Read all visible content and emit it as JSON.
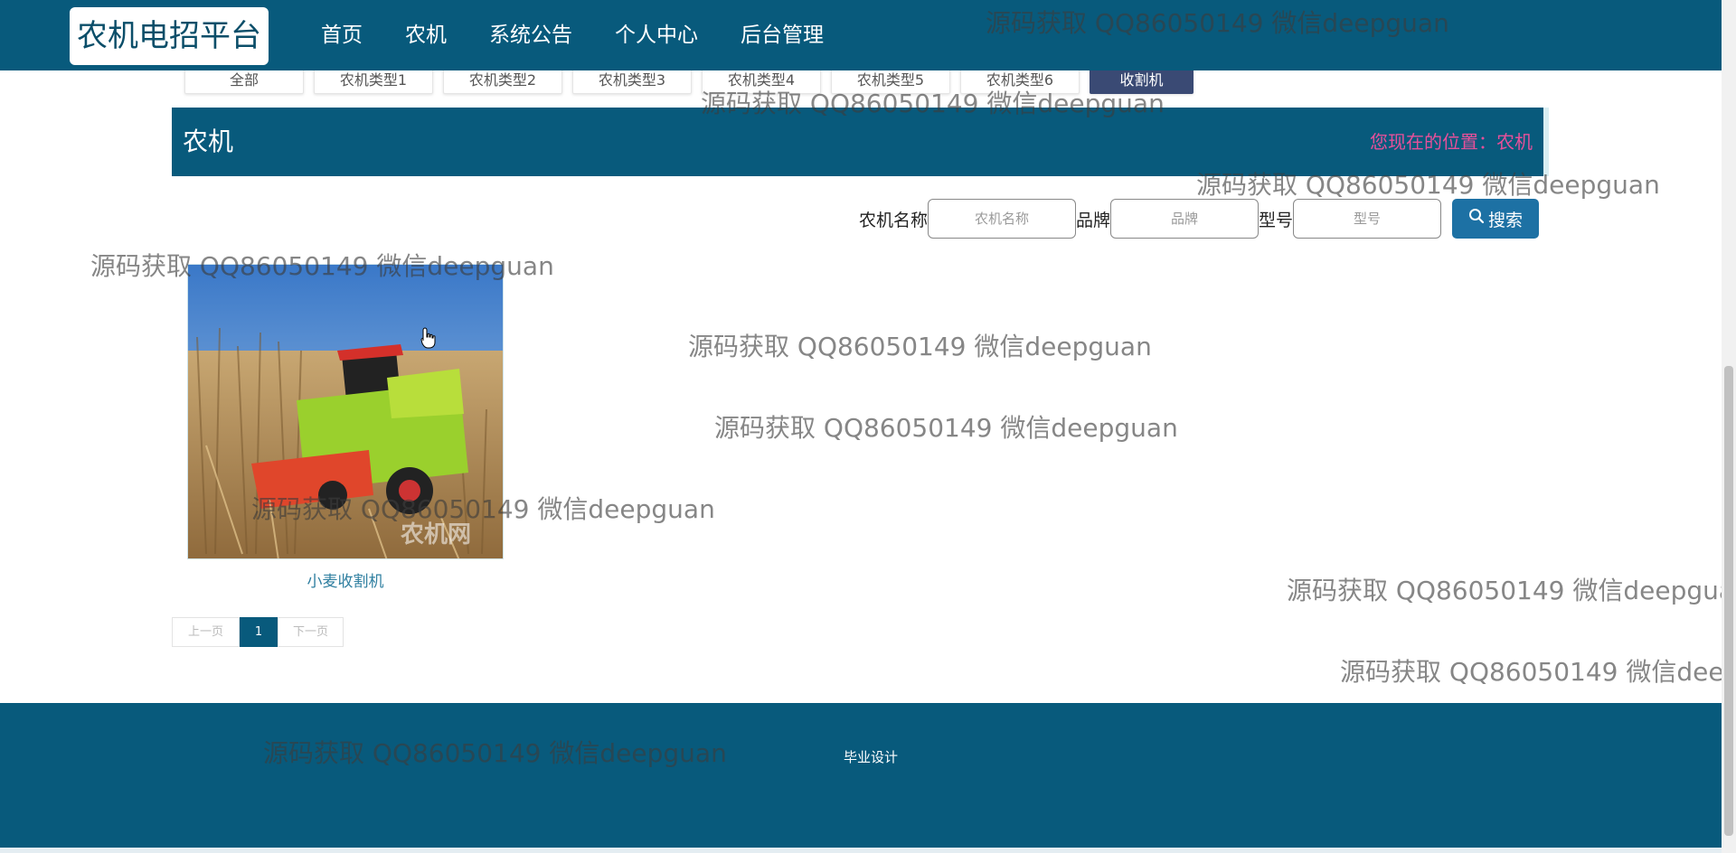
{
  "header": {
    "logo": "农机电招平台",
    "nav": [
      "首页",
      "农机",
      "系统公告",
      "个人中心",
      "后台管理"
    ]
  },
  "category_tabs": [
    "全部",
    "农机类型1",
    "农机类型2",
    "农机类型3",
    "农机类型4",
    "农机类型5",
    "农机类型6",
    "收割机"
  ],
  "active_tab": "收割机",
  "section": {
    "title": "农机",
    "location": "您现在的位置：农机"
  },
  "search": {
    "name_label": "农机名称",
    "name_placeholder": "农机名称",
    "brand_label": "品牌",
    "brand_placeholder": "品牌",
    "model_label": "型号",
    "model_placeholder": "型号",
    "button": "搜索"
  },
  "products": [
    {
      "name": "小麦收割机",
      "image_watermark": "农机网"
    }
  ],
  "pagination": {
    "prev": "上一页",
    "current": "1",
    "next": "下一页"
  },
  "footer": {
    "text": "毕业设计"
  },
  "watermark_text": "源码获取 QQ86050149 微信deepguan",
  "colors": {
    "primary": "#085a7c",
    "accent_pink": "#e8509a",
    "active_tab": "#3a4a74",
    "search_button": "#1d71a4"
  }
}
